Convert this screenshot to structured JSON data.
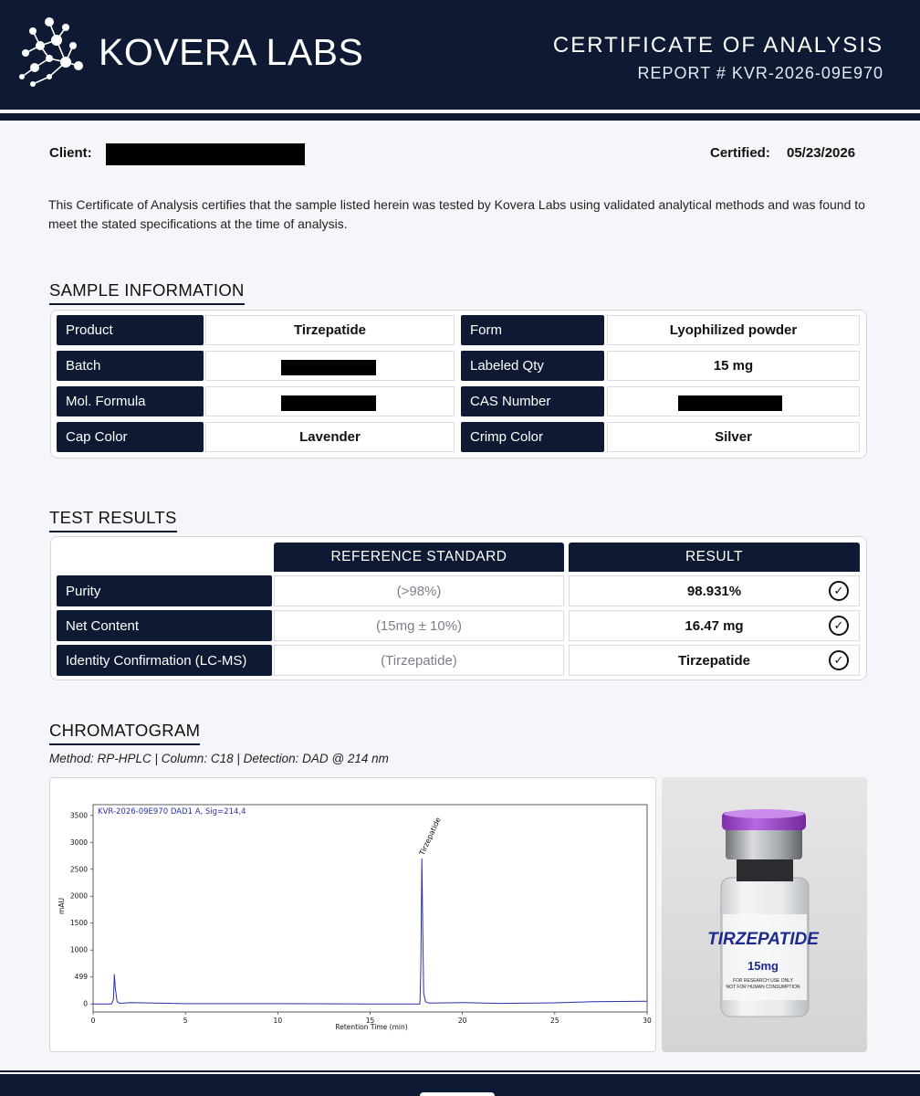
{
  "header": {
    "brand": "KOVERA LABS",
    "title": "CERTIFICATE OF ANALYSIS",
    "report": "REPORT # KVR-2026-09E970"
  },
  "client": {
    "label": "Client:"
  },
  "certified": {
    "label": "Certified:",
    "date": "05/23/2026"
  },
  "intro": "This Certificate of Analysis certifies that the sample listed herein was tested by Kovera Labs using validated analytical methods and was found to meet the stated specifications at the time of analysis.",
  "sample": {
    "title": "SAMPLE INFORMATION",
    "rows": [
      {
        "left_label": "Product",
        "left_value": "Tirzepatide",
        "right_label": "Form",
        "right_value": "Lyophilized powder"
      },
      {
        "left_label": "Batch",
        "left_value": "",
        "right_label": "Labeled Qty",
        "right_value": "15 mg"
      },
      {
        "left_label": "Mol. Formula",
        "left_value": "",
        "right_label": "CAS Number",
        "right_value": ""
      },
      {
        "left_label": "Cap Color",
        "left_value": "Lavender",
        "right_label": "Crimp Color",
        "right_value": "Silver"
      }
    ]
  },
  "tests": {
    "title": "TEST RESULTS",
    "col_reference": "REFERENCE STANDARD",
    "col_result": "RESULT",
    "rows": [
      {
        "label": "Purity",
        "reference": "(>98%)",
        "result": "98.931%"
      },
      {
        "label": "Net Content",
        "reference": "(15mg ± 10%)",
        "result": "16.47 mg"
      },
      {
        "label": "Identity Confirmation (LC-MS)",
        "reference": "(Tirzepatide)",
        "result": "Tirzepatide"
      }
    ],
    "check_glyph": "✓"
  },
  "chromatogram": {
    "title": "CHROMATOGRAM",
    "method": "Method: RP-HPLC | Column: C18 | Detection: DAD @ 214 nm"
  },
  "chart_data": {
    "type": "line",
    "title": "KVR-2026-09E970 DAD1 A, Sig=214,4",
    "xlabel": "Retention Time (min)",
    "ylabel": "mAU",
    "xlim": [
      0,
      30
    ],
    "ylim": [
      -150,
      3700
    ],
    "x_ticks": [
      0,
      5,
      10,
      15,
      20,
      25,
      30
    ],
    "y_ticks": [
      0,
      499,
      1000,
      1500,
      2000,
      2500,
      3000,
      3500
    ],
    "grid": false,
    "series": [
      {
        "color": "#2b2fae",
        "x": [
          0,
          1.0,
          1.1,
          1.15,
          1.2,
          1.3,
          1.45,
          2.0,
          5,
          10,
          15,
          17.7,
          17.75,
          17.8,
          17.85,
          17.9,
          18.0,
          18.2,
          20,
          22,
          25,
          27,
          30
        ],
        "y": [
          0,
          0,
          80,
          550,
          300,
          40,
          10,
          25,
          5,
          5,
          0,
          0,
          700,
          2700,
          1400,
          200,
          40,
          15,
          25,
          10,
          20,
          40,
          50
        ]
      }
    ],
    "annotations": [
      {
        "x": 17.8,
        "y": 2700,
        "text": "Tirzepatide"
      }
    ]
  },
  "vial": {
    "name": "TIRZEPATIDE",
    "dose": "15mg",
    "note1": "FOR RESEARCH USE ONLY",
    "note2": "NOT FOR HUMAN CONSUMPTION"
  },
  "colors": {
    "navy": "#0e1a33",
    "trace": "#2b2fae",
    "cap": "#9b3fc8"
  }
}
